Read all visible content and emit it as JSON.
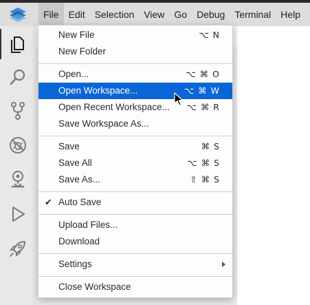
{
  "menubar": {
    "items": [
      "File",
      "Edit",
      "Selection",
      "View",
      "Go",
      "Debug",
      "Terminal",
      "Help"
    ],
    "active": "File"
  },
  "activitybar": {
    "icons": [
      "explorer-icon",
      "search-icon",
      "source-control-icon",
      "debug-icon",
      "remote-icon",
      "run-icon",
      "deploy-icon"
    ]
  },
  "file_menu": {
    "new_file": {
      "label": "New File",
      "shortcut": "⌥ N"
    },
    "new_folder": {
      "label": "New Folder",
      "shortcut": ""
    },
    "open": {
      "label": "Open...",
      "shortcut": "⌥ ⌘ O"
    },
    "open_workspace": {
      "label": "Open Workspace...",
      "shortcut": "⌥ ⌘ W"
    },
    "open_recent_workspace": {
      "label": "Open Recent Workspace...",
      "shortcut": "⌥ ⌘ R"
    },
    "save_workspace_as": {
      "label": "Save Workspace As...",
      "shortcut": ""
    },
    "save": {
      "label": "Save",
      "shortcut": "⌘ S"
    },
    "save_all": {
      "label": "Save All",
      "shortcut": "⌥ ⌘ S"
    },
    "save_as": {
      "label": "Save As...",
      "shortcut": "⇧ ⌘ S"
    },
    "auto_save": {
      "label": "Auto Save",
      "check": "✔"
    },
    "upload_files": {
      "label": "Upload Files..."
    },
    "download": {
      "label": "Download"
    },
    "settings": {
      "label": "Settings"
    },
    "close_workspace": {
      "label": "Close Workspace"
    }
  },
  "colors": {
    "highlight": "#0a66d6",
    "titlebar": "#dddddd",
    "activitybar": "#e8e8e8",
    "menu_bg": "#fdfdfd"
  }
}
